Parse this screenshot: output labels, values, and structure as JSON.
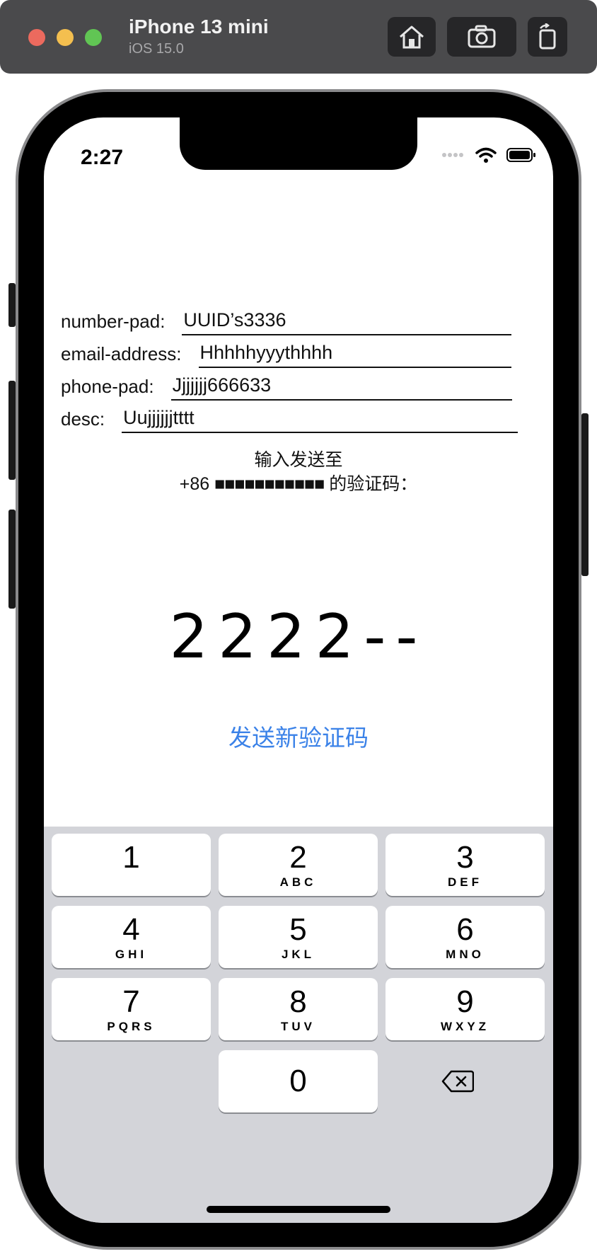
{
  "simulator": {
    "device_name": "iPhone 13 mini",
    "os_version": "iOS 15.0",
    "buttons": {
      "home": "home-icon",
      "screenshot": "camera-icon",
      "rotate": "rotate-icon"
    }
  },
  "statusbar": {
    "time": "2:27"
  },
  "form": {
    "rows": [
      {
        "label": "number-pad:",
        "value": "UUID’s3336"
      },
      {
        "label": "email-address:",
        "value": "Hhhhhyyythhhh"
      },
      {
        "label": "phone-pad:",
        "value": "Jjjjjjj666633"
      },
      {
        "label": "desc:",
        "value": "Uujjjjjjtttt"
      }
    ]
  },
  "verification": {
    "prompt_line1": "输入发送至",
    "prompt_prefix": "+86",
    "prompt_masked": "■■■■■■■■■■■",
    "prompt_suffix": "的验证码：",
    "code_display": "2222--",
    "resend_label": "发送新验证码"
  },
  "keyboard": {
    "keys": [
      {
        "num": "1",
        "letters": ""
      },
      {
        "num": "2",
        "letters": "ABC"
      },
      {
        "num": "3",
        "letters": "DEF"
      },
      {
        "num": "4",
        "letters": "GHI"
      },
      {
        "num": "5",
        "letters": "JKL"
      },
      {
        "num": "6",
        "letters": "MNO"
      },
      {
        "num": "7",
        "letters": "PQRS"
      },
      {
        "num": "8",
        "letters": "TUV"
      },
      {
        "num": "9",
        "letters": "WXYZ"
      },
      {
        "num": "0",
        "letters": ""
      }
    ],
    "delete_icon": "delete-backspace-icon"
  },
  "colors": {
    "accent": "#3b82e8",
    "keyboard_bg": "#d3d4d9",
    "titlebar_bg": "#4a4a4c"
  }
}
